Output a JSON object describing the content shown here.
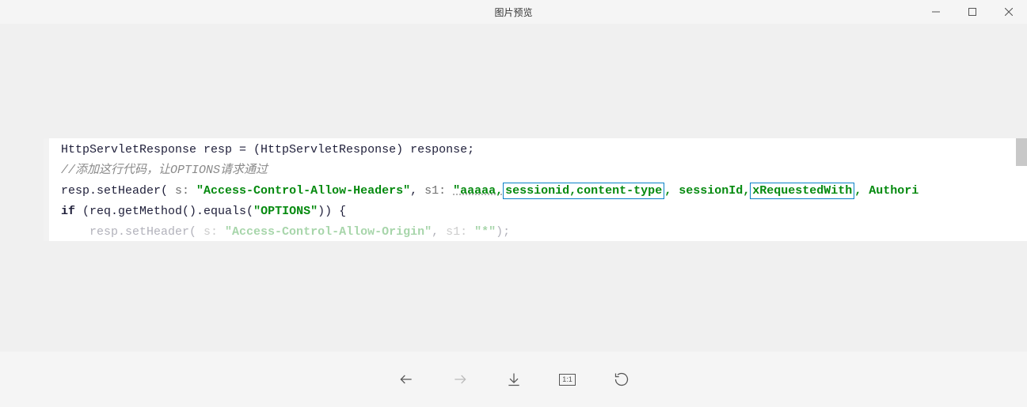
{
  "window": {
    "title": "图片预览"
  },
  "code": {
    "line1": {
      "text": "HttpServletResponse resp = (HttpServletResponse) response;"
    },
    "line2": {
      "comment": "//添加这行代码，让OPTIONS请求通过"
    },
    "line3": {
      "prefix": "resp.setHeader(",
      "param1": " s: ",
      "str1": "\"Access-Control-Allow-Headers\"",
      "sep": ",  ",
      "param2": " s1: ",
      "str2a": "\"aaaaa,",
      "hl1a": "sessionid",
      "mid1": ",",
      "hl1b": "content-type",
      "mid2": ", sessionId,",
      "hl2a": "xRequestedWith",
      "tail": ", Authori"
    },
    "line4": {
      "kw": "if",
      "text1": " (req.getMethod().equals(",
      "str": "\"OPTIONS\"",
      "text2": ")) {"
    },
    "line5": {
      "prefix": "resp.setHeader(",
      "param1": " s: ",
      "str1": "\"Access-Control-Allow-Origin\"",
      "sep": ",  ",
      "param2": " s1: ",
      "str2": "\"*\"",
      "suffix": ");"
    }
  },
  "toolbar": {
    "ratio": "1:1"
  }
}
